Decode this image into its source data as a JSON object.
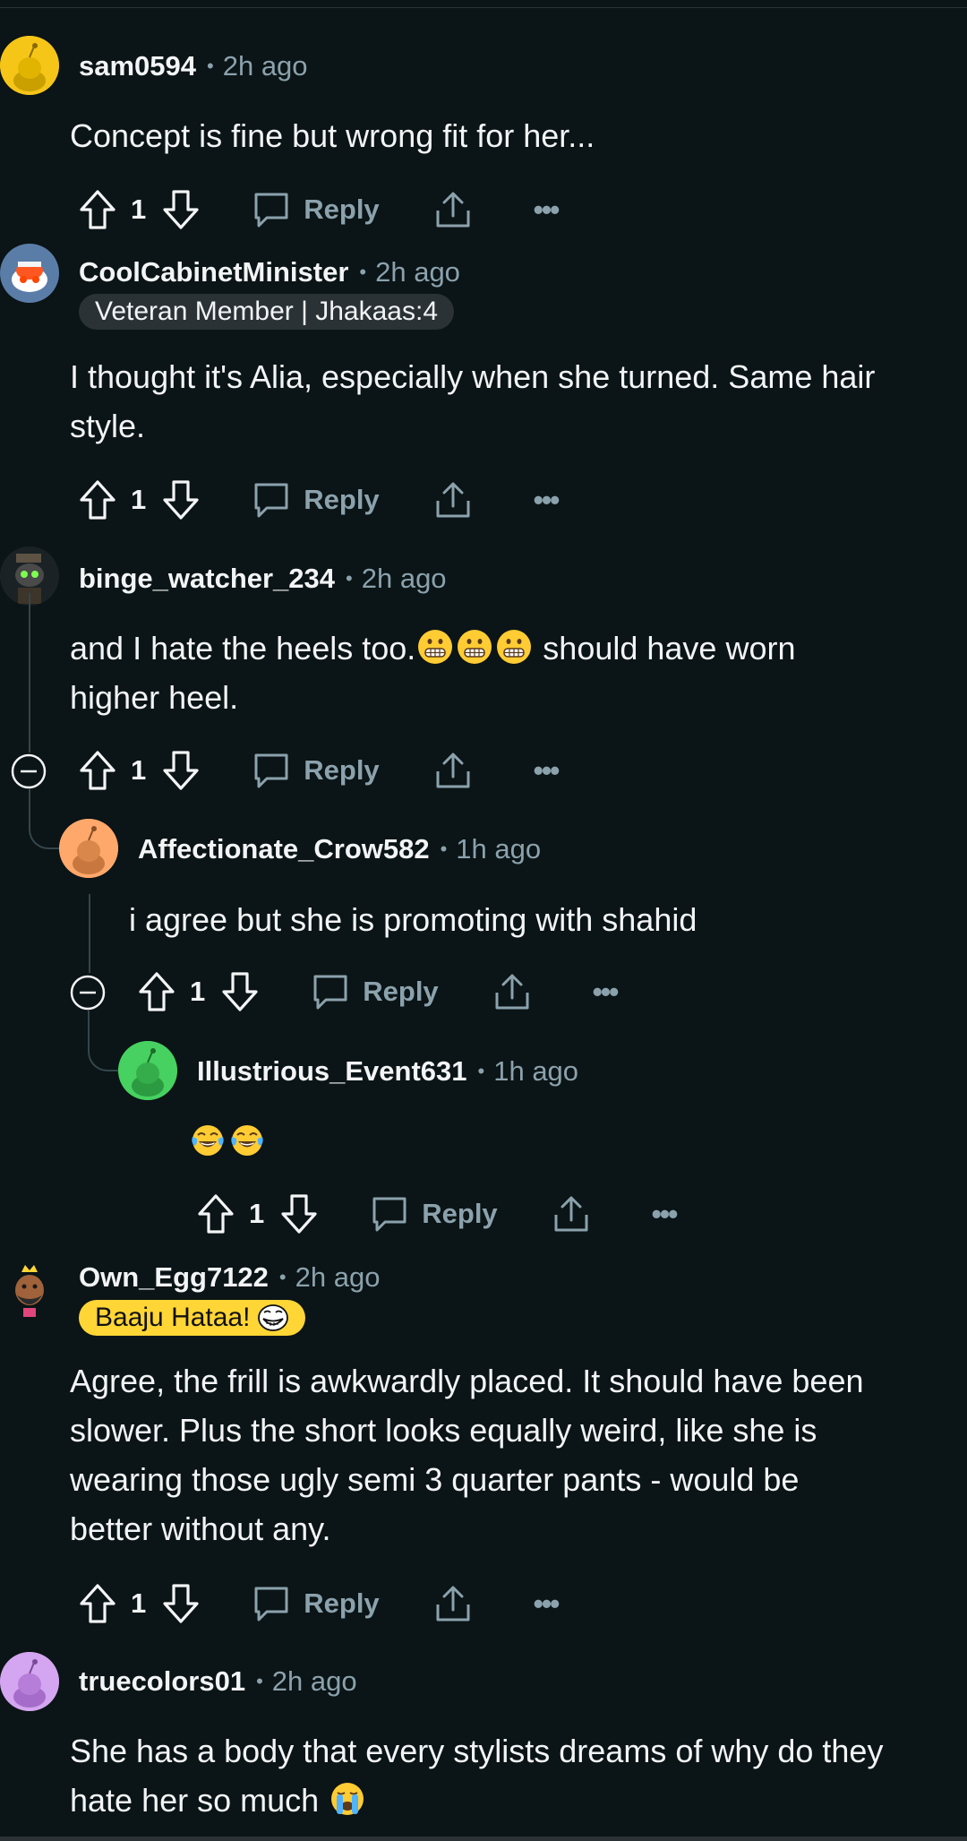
{
  "comments": [
    {
      "username": "sam0594",
      "time": "2h ago",
      "flair": "",
      "body": "Concept is fine but wrong fit for her...",
      "votes": "1",
      "reply_label": "Reply"
    },
    {
      "username": "CoolCabinetMinister",
      "time": "2h ago",
      "flair": "Veteran Member | Jhakaas:4",
      "body_line1": "I thought it's Alia, especially when she turned. Same hair",
      "body_line2": "style.",
      "votes": "1",
      "reply_label": "Reply"
    },
    {
      "username": "binge_watcher_234",
      "time": "2h ago",
      "body_line1_pre": "and I hate the heels too.",
      "body_line1_post": " should have worn",
      "body_line2": "higher heel.",
      "emoji_desc": "grimacing-face x3",
      "votes": "1",
      "reply_label": "Reply"
    },
    {
      "username": "Affectionate_Crow582",
      "time": "1h ago",
      "body": "i agree but she is promoting with shahid",
      "votes": "1",
      "reply_label": "Reply"
    },
    {
      "username": "Illustrious_Event631",
      "time": "1h ago",
      "emoji_desc": "tears-of-joy x2",
      "votes": "1",
      "reply_label": "Reply"
    },
    {
      "username": "Own_Egg7122",
      "time": "2h ago",
      "flair": "Baaju Hataa!",
      "body_lines": [
        "Agree, the frill is awkwardly placed. It should have been",
        "slower. Plus the short looks equally weird, like she is",
        "wearing those ugly semi 3 quarter pants - would be",
        "better without any."
      ],
      "votes": "1",
      "reply_label": "Reply"
    },
    {
      "username": "truecolors01",
      "time": "2h ago",
      "body_line1": "She has a body that every stylists dreams of why do they",
      "body_line2": "hate her so much",
      "emoji_desc": "loudly-crying-face"
    }
  ],
  "colors": {
    "background": "#0b1416",
    "text": "#f2f4f5",
    "muted": "#8ba2ad",
    "flair_gray": "#2a3236",
    "flair_yellow": "#ffd635",
    "thread_line": "#33464c"
  }
}
